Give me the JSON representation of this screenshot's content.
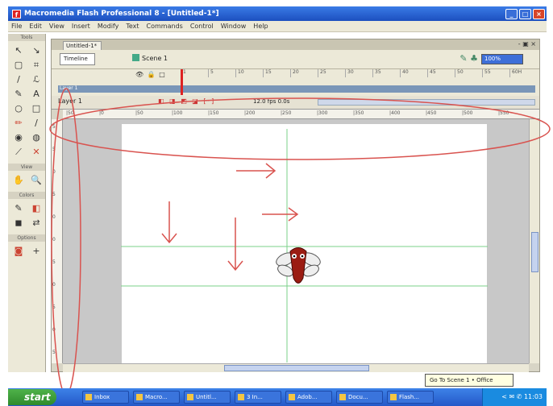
{
  "window": {
    "title": "Macromedia Flash Professional 8 - [Untitled-1*]",
    "minimize": "_",
    "maximize": "□",
    "close": "×"
  },
  "menu": [
    "File",
    "Edit",
    "View",
    "Insert",
    "Modify",
    "Text",
    "Commands",
    "Control",
    "Window",
    "Help"
  ],
  "tools": {
    "header": "Tools",
    "items": [
      "↖",
      "↘",
      "▢",
      "⌗",
      "/",
      "ℒ",
      "✎",
      "A",
      "○",
      "□",
      "✏",
      "∕",
      "◉",
      "◍",
      "⟋",
      "✕"
    ],
    "view_header": "View",
    "view_items": [
      "✋",
      "🔍"
    ],
    "colors_header": "Colors",
    "color_items": [
      "✎",
      "◧",
      "◼",
      "⇄"
    ],
    "options_header": "Options",
    "option_items": [
      "◙",
      "+"
    ]
  },
  "document": {
    "tab": "Untitled-1*",
    "tab_close": "- ▣ ×",
    "timeline_button": "Timeline",
    "scene": "Scene 1",
    "zoom": "100%",
    "edit_icons": "✎ ♣",
    "timeline": {
      "lock_icons": "👁 🔒 □",
      "frames": [
        "1",
        "5",
        "10",
        "15",
        "20",
        "25",
        "30",
        "35",
        "40",
        "45",
        "50",
        "55",
        "60H"
      ],
      "layer": "Layer 1",
      "add_layer": "Layer 1",
      "controls": "◧ ◨ ◩ ◪ [·]",
      "frame_rate": "12.0 fps   0.0s"
    },
    "ruler_h": [
      "|50",
      "|0",
      "|50",
      "|100",
      "|150",
      "|200",
      "|250",
      "|300",
      "|350",
      "|400",
      "|450",
      "|500",
      "|550"
    ],
    "ruler_v": [
      "5",
      "5",
      "0",
      "5",
      "0",
      "0",
      "5",
      "0",
      "5",
      "0",
      "5"
    ]
  },
  "tooltip": "Go To Scene 1 • Office",
  "taskbar": {
    "start": "start",
    "items": [
      "Inbox",
      "Macro...",
      "Untitl...",
      "3 In...",
      "Adob...",
      "Docu...",
      "Flash..."
    ],
    "tray": "< ✉ ✆ 11:03"
  },
  "colors": {
    "annotation_red": "#d9534f",
    "guide_green": "#7bd08a",
    "titlebar": "#1c4fbf"
  }
}
